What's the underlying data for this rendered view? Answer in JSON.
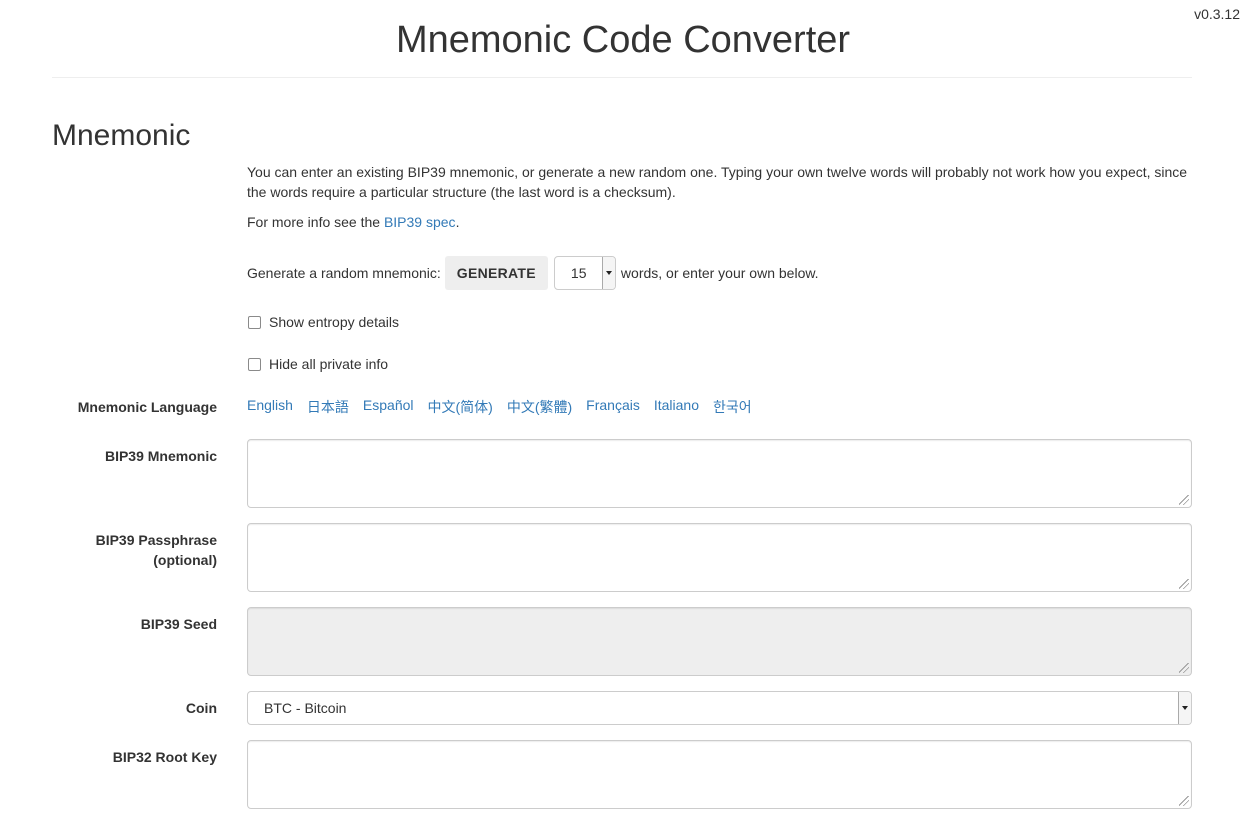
{
  "version": "v0.3.12",
  "title": "Mnemonic Code Converter",
  "section": {
    "heading": "Mnemonic",
    "intro": "You can enter an existing BIP39 mnemonic, or generate a new random one. Typing your own twelve words will probably not work how you expect, since the words require a particular structure (the last word is a checksum).",
    "spec_prefix": "For more info see the ",
    "spec_link": "BIP39 spec",
    "spec_suffix": "."
  },
  "generate": {
    "prefix": "Generate a random mnemonic:",
    "button": "GENERATE",
    "word_count": "15",
    "suffix": "words, or enter your own below."
  },
  "options": {
    "show_entropy": "Show entropy details",
    "hide_private": "Hide all private info"
  },
  "language": {
    "label": "Mnemonic Language",
    "items": [
      "English",
      "日本語",
      "Español",
      "中文(简体)",
      "中文(繁體)",
      "Français",
      "Italiano",
      "한국어"
    ]
  },
  "fields": {
    "mnemonic_label": "BIP39 Mnemonic",
    "passphrase_label_1": "BIP39 Passphrase",
    "passphrase_label_2": "(optional)",
    "seed_label": "BIP39 Seed",
    "coin_label": "Coin",
    "coin_value": "BTC - Bitcoin",
    "root_key_label": "BIP32 Root Key"
  },
  "colors": {
    "link": "#337ab7",
    "text": "#333333",
    "readonly_bg": "#eeeeee"
  }
}
